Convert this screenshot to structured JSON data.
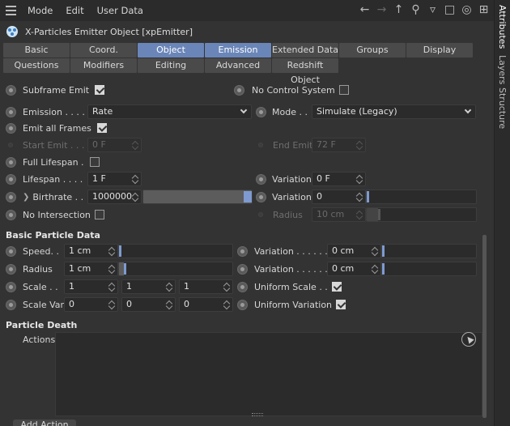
{
  "menu": {
    "items": [
      "Mode",
      "Edit",
      "User Data"
    ]
  },
  "object": {
    "title": "X-Particles Emitter Object [xpEmitter]"
  },
  "tabs": {
    "row1": [
      "Basic",
      "Coord.",
      "Object",
      "Emission",
      "Extended Data",
      "Groups",
      "Display"
    ],
    "row2": [
      "Questions",
      "Modifiers",
      "Editing",
      "Advanced",
      "Redshift Object"
    ],
    "active": [
      "Object",
      "Emission"
    ]
  },
  "side_tabs": [
    "Attributes",
    "Layers",
    "Structure"
  ],
  "emission": {
    "subframe_emit": {
      "label": "Subframe Emit",
      "checked": true
    },
    "no_control_system": {
      "label": "No Control System",
      "checked": false
    },
    "emission": {
      "label": "Emission . . . .",
      "value": "Rate"
    },
    "mode": {
      "label": "Mode . .",
      "value": "Simulate (Legacy)"
    },
    "emit_all_frames": {
      "label": "Emit all Frames",
      "checked": true
    },
    "start_emit": {
      "label": "Start Emit . . .",
      "value": "0 F"
    },
    "end_emit": {
      "label": "End Emit",
      "value": "72 F"
    },
    "full_lifespan": {
      "label": "Full Lifespan .",
      "checked": false
    },
    "lifespan": {
      "label": "Lifespan . . . .",
      "value": "1 F"
    },
    "lifespan_variation": {
      "label": "Variation",
      "value": "0 F"
    },
    "birthrate": {
      "label": "Birthrate . .",
      "value": "1000000",
      "slider": 1.0
    },
    "birthrate_variation": {
      "label": "Variation",
      "value": "0",
      "slider": 0.0
    },
    "no_intersection": {
      "label": "No Intersection",
      "checked": false
    },
    "radius": {
      "label": "Radius",
      "value": "10 cm",
      "slider": 0.1
    }
  },
  "basic_particle": {
    "title": "Basic Particle Data",
    "speed": {
      "label": "Speed. .",
      "value": "1 cm",
      "slider": 0.0
    },
    "speed_variation": {
      "label": "Variation . . . . . .",
      "value": "0 cm",
      "slider": 0.0
    },
    "radius": {
      "label": "Radius",
      "value": "1 cm",
      "slider": 0.04
    },
    "radius_variation": {
      "label": "Variation . . . . . .",
      "value": "0 cm",
      "slider": 0.0
    },
    "scale": {
      "label": "Scale . .",
      "values": [
        "1",
        "1",
        "1"
      ]
    },
    "uniform_scale": {
      "label": "Uniform Scale . .",
      "checked": true
    },
    "scale_var": {
      "label": "Scale Var.",
      "values": [
        "0",
        "0",
        "0"
      ]
    },
    "uniform_variation": {
      "label": "Uniform Variation",
      "checked": true
    }
  },
  "particle_death": {
    "title": "Particle Death",
    "actions_label": "Actions",
    "add_action": "Add Action"
  }
}
